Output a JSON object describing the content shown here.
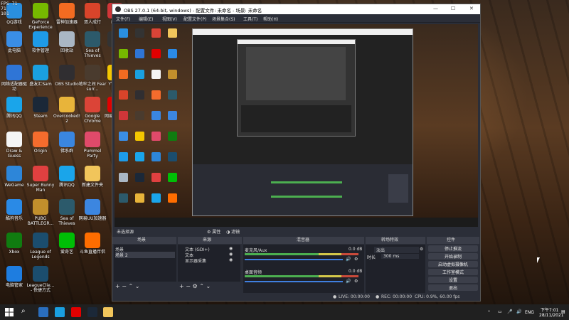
{
  "fps_overlay": {
    "line1": "FPS 71",
    "line2": "71",
    "line3": "101"
  },
  "desktop_icons": [
    {
      "label": "QQ游戏",
      "color": "#2a8fe0"
    },
    {
      "label": "GeForce Experience",
      "color": "#76b900"
    },
    {
      "label": "雷神加速器",
      "color": "#f36b21"
    },
    {
      "label": "双人成行",
      "color": "#d9442a"
    },
    {
      "label": "Riot",
      "color": "#d13639"
    },
    {
      "label": "此电脑",
      "color": "#3a8ee6"
    },
    {
      "label": "软件管理",
      "color": "#1e9be8"
    },
    {
      "label": "回收站",
      "color": "#aab7c4"
    },
    {
      "label": "Sea of Thieves",
      "color": "#2c5a6b"
    },
    {
      "label": "(战",
      "color": "#333333"
    },
    {
      "label": "网络适配器驱动",
      "color": "#2f75d6"
    },
    {
      "label": "盛友汇Sam",
      "color": "#1aa0e0"
    },
    {
      "label": "OBS Studio",
      "color": "#302e31"
    },
    {
      "label": "地牢之间 Fear surr...",
      "color": "#4a3b2e"
    },
    {
      "label": "YY语音",
      "color": "#f4c600"
    },
    {
      "label": "腾讯QQ",
      "color": "#1aa5ea"
    },
    {
      "label": "Steam",
      "color": "#1b2838"
    },
    {
      "label": "Overcooked! 2",
      "color": "#e8b43a"
    },
    {
      "label": "Google Chrome",
      "color": "#db4437"
    },
    {
      "label": "网易云音乐",
      "color": "#e20000"
    },
    {
      "label": "Draw & Guess",
      "color": "#f5f5f5"
    },
    {
      "label": "Origin",
      "color": "#f56c2d"
    },
    {
      "label": "佛系群",
      "color": "#3a86e0"
    },
    {
      "label": "Pummel Party",
      "color": "#e04a6a"
    },
    {
      "label": "WeGame",
      "color": "#2d86d9"
    },
    {
      "label": "Super Bunny Man",
      "color": "#e04040"
    },
    {
      "label": "腾讯QQ",
      "color": "#1aa5ea"
    },
    {
      "label": "新建文件夹",
      "color": "#f1c55b"
    },
    {
      "label": "酷狗音乐",
      "color": "#2a8ae6"
    },
    {
      "label": "PUBG BATTLEGR...",
      "color": "#c28f2c"
    },
    {
      "label": "Sea of Thieves",
      "color": "#2c5a6b"
    },
    {
      "label": "网易UU加速器",
      "color": "#3c86e0"
    },
    {
      "label": "Xbox",
      "color": "#107c10"
    },
    {
      "label": "League of Legends",
      "color": "#1b4d6e"
    },
    {
      "label": "爱奇艺",
      "color": "#00be06"
    },
    {
      "label": "斗鱼直播伴侣",
      "color": "#ff6d00"
    },
    {
      "label": "电脑管家",
      "color": "#1e7de0"
    },
    {
      "label": "LeagueClie... - 快捷方式",
      "color": "#1b4d6e"
    }
  ],
  "obs": {
    "title": "OBS 27.0.1 (64-bit, windows) - 配置文件: 未命名 - 场景: 未命名",
    "menu": [
      "文件(F)",
      "编辑(E)",
      "视图(V)",
      "配置文件(P)",
      "场景集合(S)",
      "工具(T)",
      "帮助(H)"
    ],
    "window_controls": {
      "minimize": "—",
      "maximize": "☐",
      "close": "✕"
    },
    "no_source_label": "未选择源",
    "props_button": "属性",
    "filters_button": "滤镜",
    "docks": {
      "scenes": {
        "title": "场景",
        "items": [
          "场景",
          "场景 2"
        ]
      },
      "sources": {
        "title": "来源",
        "items": [
          "文本 (GDI+)",
          "文本",
          "显示器采集"
        ]
      },
      "mixer": {
        "title": "混音器",
        "tracks": [
          {
            "name": "麦克风/Aux",
            "db": "0.0 dB"
          },
          {
            "name": "桌面音频",
            "db": "0.0 dB"
          }
        ]
      },
      "transitions": {
        "title": "转场特效",
        "type": "淡出",
        "duration_label": "时长",
        "duration": "300 ms"
      },
      "controls": {
        "title": "控件",
        "buttons": [
          "停止推流",
          "开始录制",
          "启动虚拟摄像机",
          "工作室模式",
          "设置",
          "退出"
        ]
      }
    },
    "status": {
      "live": "LIVE: 00:00:00",
      "rec": "REC: 00:00:00",
      "cpu": "CPU: 0.9%, 60.00 fps"
    }
  },
  "taskbar": {
    "time": "下午7:01",
    "date": "28/11/2021",
    "lang": "ENG",
    "icons": [
      "windows-icon",
      "search-icon",
      "task-view-icon",
      "browser-icon",
      "netease-icon",
      "steam-icon",
      "obs-icon",
      "folder-icon"
    ]
  }
}
